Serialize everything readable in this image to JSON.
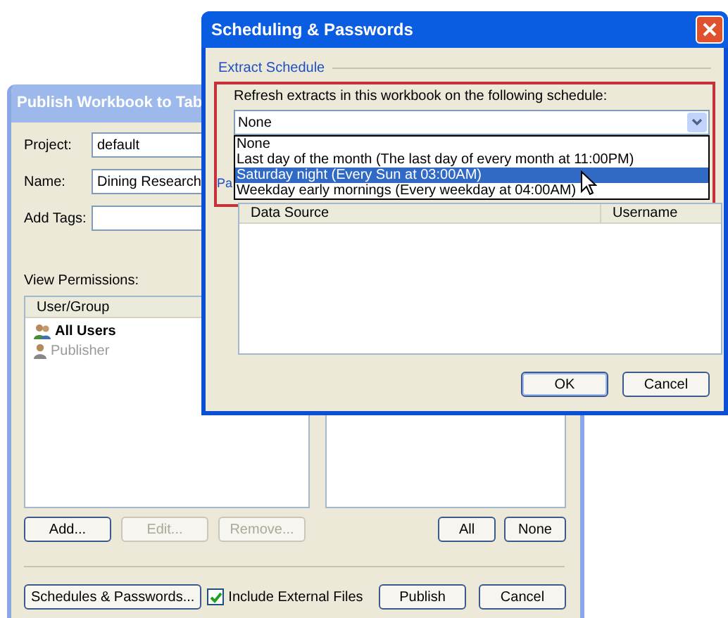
{
  "publish_window": {
    "title": "Publish Workbook to Tab",
    "fields": [
      {
        "label": "Project:",
        "value": "default"
      },
      {
        "label": "Name:",
        "value": "Dining Research"
      },
      {
        "label": "Add Tags:"
      }
    ],
    "permissions_label": "View Permissions:",
    "permissions_columns": [
      "User/Group"
    ],
    "users": [
      {
        "name": "All Users",
        "kind": "group"
      },
      {
        "name": "Publisher",
        "kind": "user"
      }
    ],
    "list_buttons": [
      {
        "label": "Add...",
        "disabled": false
      },
      {
        "label": "Edit...",
        "disabled": true
      },
      {
        "label": "Remove...",
        "disabled": true
      }
    ],
    "select_buttons": [
      "All",
      "None"
    ],
    "schedules_button": "Schedules & Passwords...",
    "include_external": {
      "label": "Include External Files",
      "checked": true
    },
    "footer_buttons": [
      "Publish",
      "Cancel"
    ]
  },
  "scheduling_window": {
    "title": "Scheduling & Passwords",
    "section": "Extract Schedule",
    "schedule_label": "Refresh extracts in this workbook on the following schedule:",
    "schedule_value": "None",
    "options": [
      {
        "label": "None",
        "selected": false
      },
      {
        "label": "Last day of the month (The last day of every month at 11:00PM)",
        "selected": false
      },
      {
        "label": "Saturday night (Every Sun at 03:00AM)",
        "selected": true
      },
      {
        "label": "Weekday early mornings (Every weekday at 04:00AM)",
        "selected": false
      }
    ],
    "hidden_label": "Pa",
    "table_columns": [
      "Data Source",
      "Username"
    ],
    "buttons": [
      "OK",
      "Cancel"
    ]
  }
}
